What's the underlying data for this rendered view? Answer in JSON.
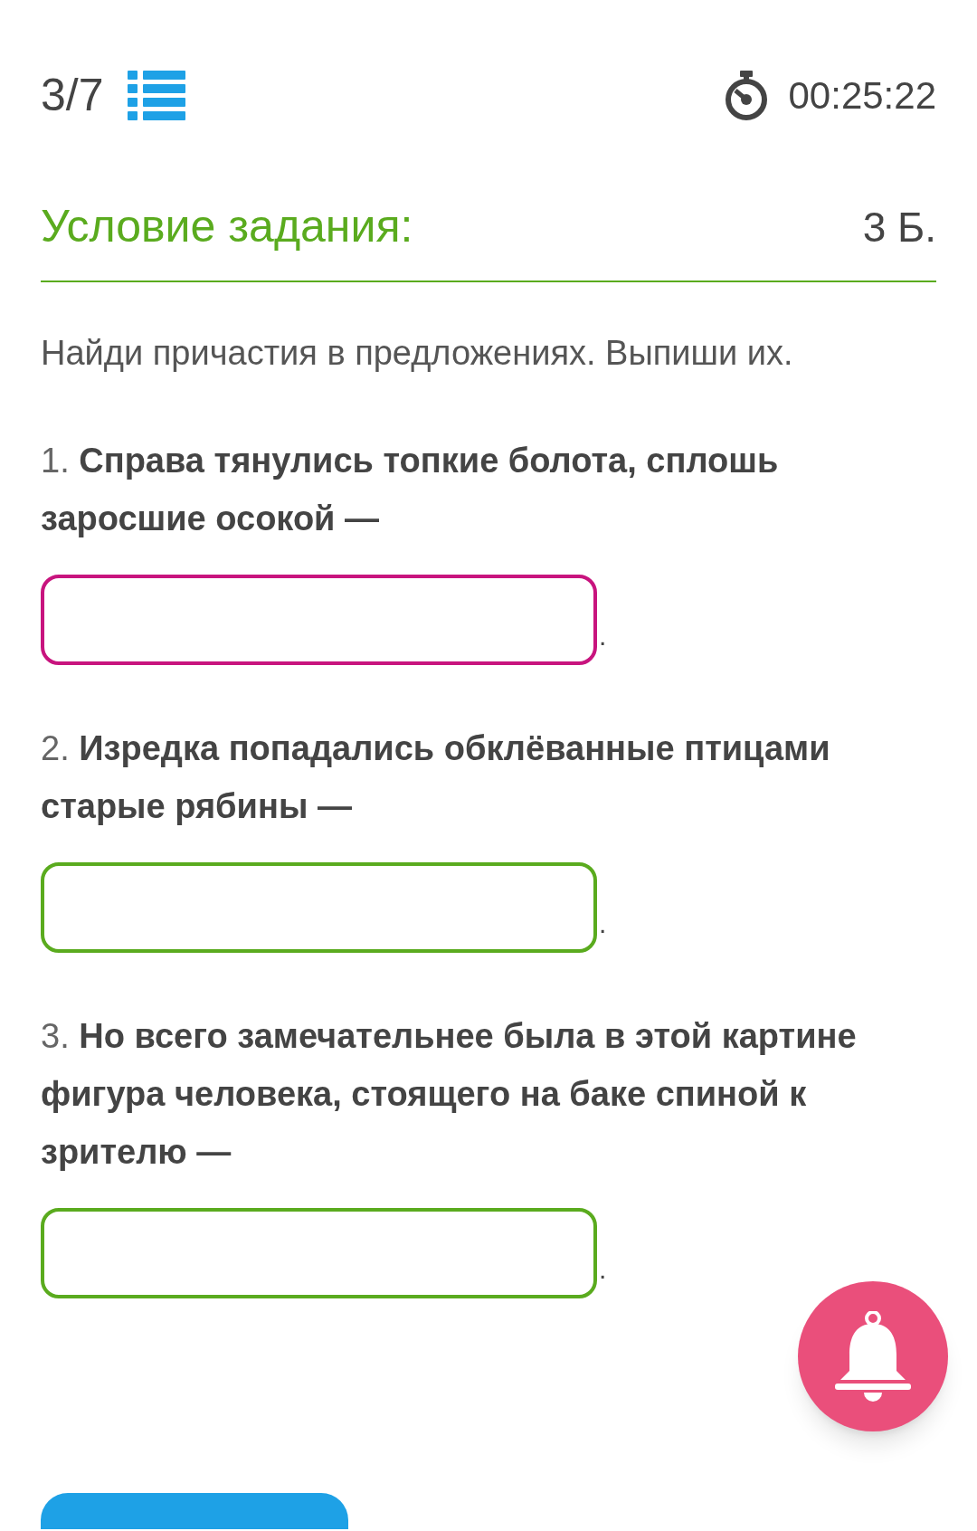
{
  "header": {
    "progress": "3/7",
    "timer": "00:25:22"
  },
  "task": {
    "title": "Условие задания:",
    "points": "3 Б.",
    "instruction": "Найди причастия в предложениях. Выпиши их."
  },
  "questions": [
    {
      "number": "1.",
      "text": "Справа тянулись топкие болота, сплошь заросшие осокой —",
      "focused": true,
      "end": "."
    },
    {
      "number": "2.",
      "text": "Изредка попадались обклёванные птицами старые рябины —",
      "focused": false,
      "end": "."
    },
    {
      "number": "3.",
      "text": "Но всего замечательнее была в этой картине фигура человека, стоящего на баке спиной к зрителю —",
      "focused": false,
      "end": "."
    }
  ]
}
